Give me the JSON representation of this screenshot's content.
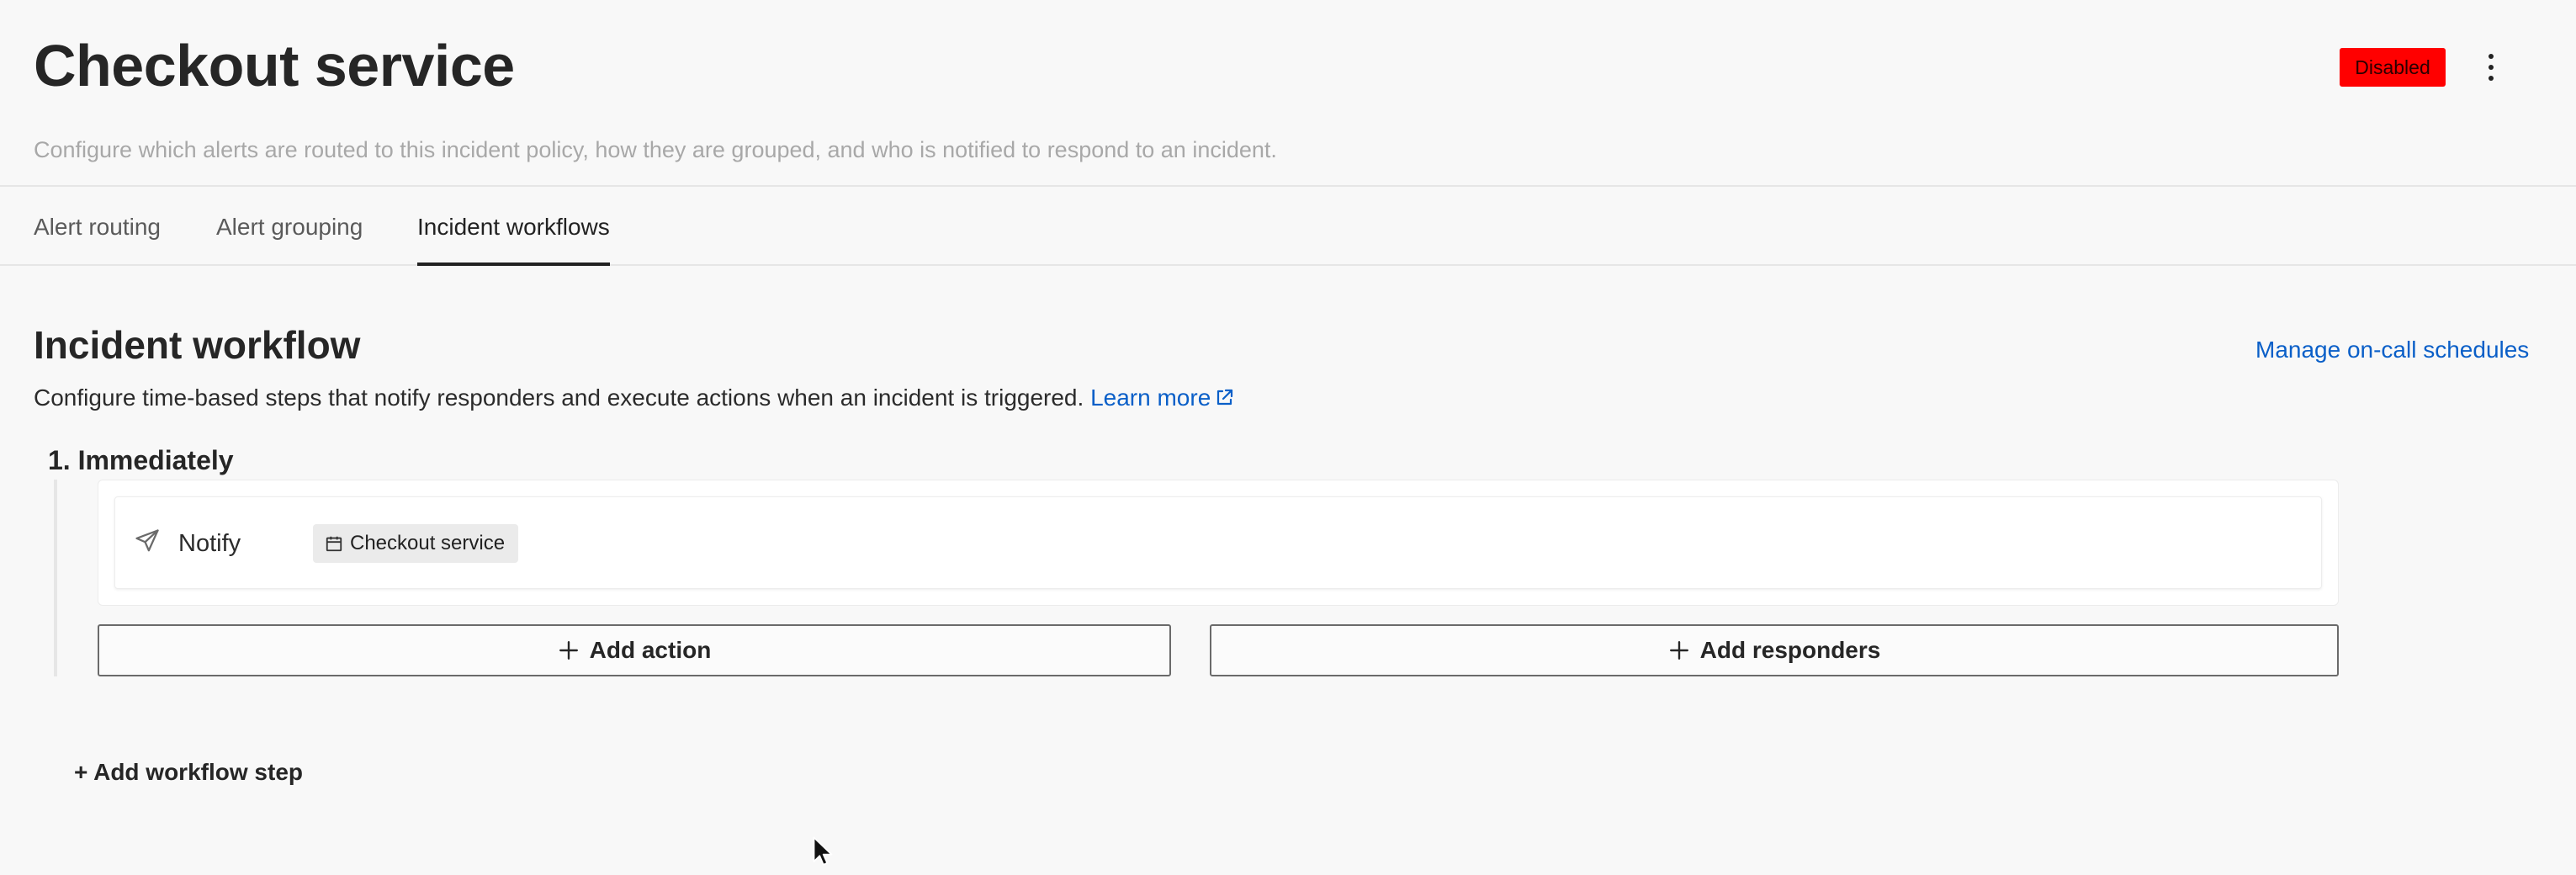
{
  "header": {
    "title": "Checkout service",
    "status": "Disabled",
    "subtitle": "Configure which alerts are routed to this incident policy, how they are grouped, and who is notified to respond to an incident."
  },
  "tabs": [
    {
      "label": "Alert routing",
      "active": false
    },
    {
      "label": "Alert grouping",
      "active": false
    },
    {
      "label": "Incident workflows",
      "active": true
    }
  ],
  "workflow": {
    "title": "Incident workflow",
    "manage_link": "Manage on-call schedules",
    "description": "Configure time-based steps that notify responders and execute actions when an incident is triggered.",
    "learn_more": "Learn more",
    "steps": [
      {
        "title": "1. Immediately",
        "action": {
          "icon": "send-icon",
          "label": "Notify",
          "target_icon": "calendar-icon",
          "target": "Checkout service"
        }
      }
    ],
    "add_action_label": "Add action",
    "add_responders_label": "Add responders",
    "add_step_label": "+ Add workflow step"
  },
  "colors": {
    "link": "#0a5fc8",
    "status_badge": "#ff0000",
    "background": "#f8f8f8"
  }
}
